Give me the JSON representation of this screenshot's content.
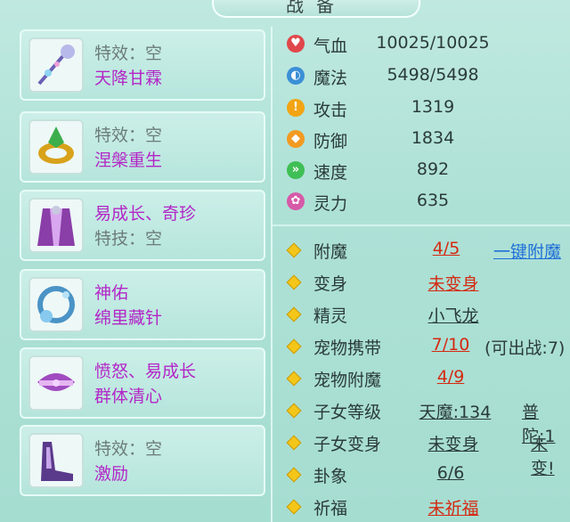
{
  "title": "战备",
  "items": [
    {
      "line1": "特效：空",
      "line2": "天降甘霖",
      "icon": "staff-icon"
    },
    {
      "line1": "特效：空",
      "line2": "涅槃重生",
      "icon": "ring-icon"
    },
    {
      "line1": "易成长、奇珍",
      "line2": "特技：空",
      "icon": "robe-icon"
    },
    {
      "line1": "神佑",
      "line2": "绵里藏针",
      "icon": "bracelet-icon"
    },
    {
      "line1": "愤怒、易成长",
      "line2": "群体清心",
      "icon": "belt-icon"
    },
    {
      "line1": "特效：空",
      "line2": "激励",
      "icon": "shoes-icon"
    }
  ],
  "stats": [
    {
      "label": "气血",
      "value": "10025/10025",
      "color": "#e0474b",
      "glyph": "♥"
    },
    {
      "label": "魔法",
      "value": "5498/5498",
      "color": "#3a8fd6",
      "glyph": "◐"
    },
    {
      "label": "攻击",
      "value": "1319",
      "color": "#f2a413",
      "glyph": "!"
    },
    {
      "label": "防御",
      "value": "1834",
      "color": "#f29a22",
      "glyph": "◆"
    },
    {
      "label": "速度",
      "value": "892",
      "color": "#3fbf55",
      "glyph": "»"
    },
    {
      "label": "灵力",
      "value": "635",
      "color": "#d65aa8",
      "glyph": "✿"
    }
  ],
  "attrs": {
    "fumo": {
      "label": "附魔",
      "value": "4/5",
      "link": "一键附魔"
    },
    "bianshen": {
      "label": "变身",
      "value": "未变身"
    },
    "jingling": {
      "label": "精灵",
      "value": "小飞龙"
    },
    "pet_carry": {
      "label": "宠物携带",
      "value": "7/10",
      "extra": "(可出战:7)"
    },
    "pet_fumo": {
      "label": "宠物附魔",
      "value": "4/9"
    },
    "child_level": {
      "label": "子女等级",
      "value": "天魔:134",
      "extra": "普陀:1"
    },
    "child_bianshen": {
      "label": "子女变身",
      "value": "未变身",
      "extra": "未变!"
    },
    "guaxiang": {
      "label": "卦象",
      "value": "6/6"
    },
    "qifu": {
      "label": "祈福",
      "value": "未祈福"
    }
  }
}
